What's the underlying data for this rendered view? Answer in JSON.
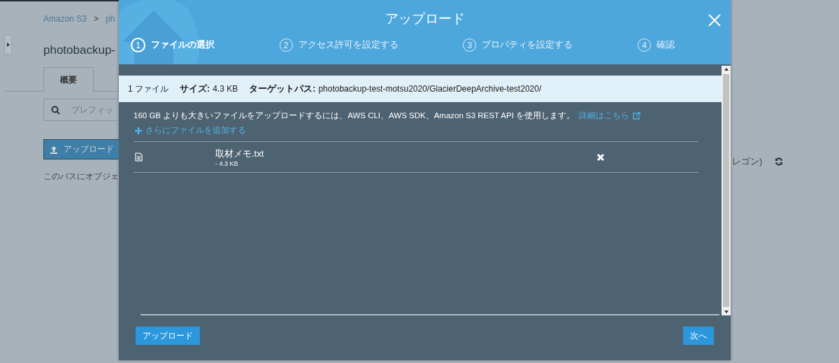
{
  "background": {
    "breadcrumb": [
      {
        "label": "Amazon S3"
      },
      {
        "label": "ph"
      }
    ],
    "breadcrumb_separator": ">",
    "bucket_title": "photobackup-",
    "tabs": [
      {
        "label": "概要",
        "selected": true
      }
    ],
    "search": {
      "placeholder": "プレフィッ"
    },
    "upload_button": "アップロード",
    "empty_message": "このパスにオブジェ",
    "region_text": "レゴン)"
  },
  "modal": {
    "title": "アップロード",
    "steps": [
      {
        "number": "1",
        "label": "ファイルの選択",
        "selected": true
      },
      {
        "number": "2",
        "label": "アクセス許可を設定する",
        "selected": false
      },
      {
        "number": "3",
        "label": "プロパティを設定する",
        "selected": false
      },
      {
        "number": "4",
        "label": "確認",
        "selected": false
      }
    ],
    "summary": {
      "file_count": "1 ファイル",
      "size_label": "サイズ:",
      "size_value": "4.3 KB",
      "target_label": "ターゲットパス:",
      "target_value": "photobackup-test-motsu2020/GlacierDeepArchive-test2020/"
    },
    "notice": "160 GB よりも大きいファイルをアップロードするには、AWS CLI、AWS SDK、Amazon S3 REST API を使用します。",
    "notice_link": "詳細はこちら",
    "add_files": "さらにファイルを追加する",
    "files": [
      {
        "name": "取材メモ.txt",
        "size": "- 4.3 KB"
      }
    ],
    "buttons": [
      {
        "label": "アップロード"
      },
      {
        "label": "次へ"
      }
    ]
  }
}
